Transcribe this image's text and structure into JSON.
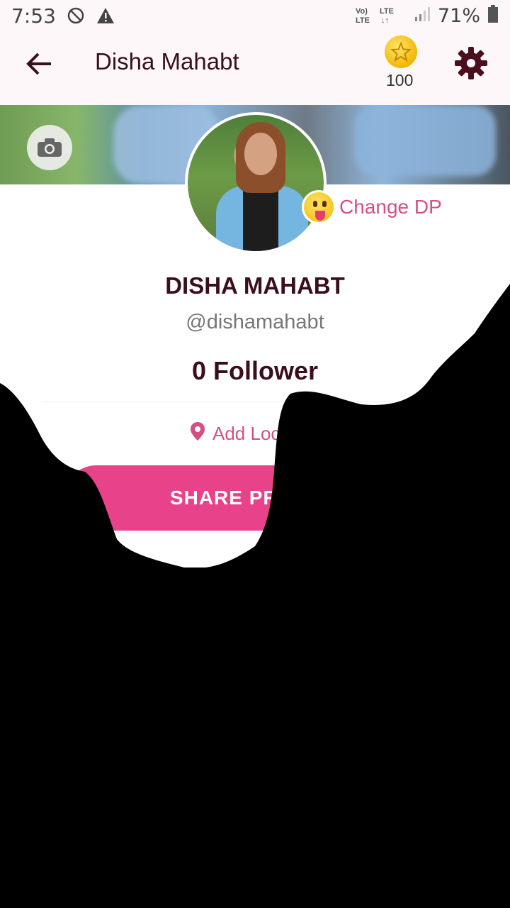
{
  "status_bar": {
    "time": "7:53",
    "network_label": "Vo) LTE LTE",
    "battery_percent": "71%"
  },
  "app_bar": {
    "title": "Disha Mahabt",
    "coins": "100"
  },
  "profile": {
    "change_dp_label": "Change DP",
    "display_name": "DISHA MAHABT",
    "handle": "@dishamahabt",
    "followers": "0 Follower",
    "location_label": "Add Location",
    "share_button": "SHARE PROFILE"
  },
  "colors": {
    "accent_pink": "#e8428a",
    "title_maroon": "#3a0f1c",
    "background": "#fdf7fa"
  }
}
